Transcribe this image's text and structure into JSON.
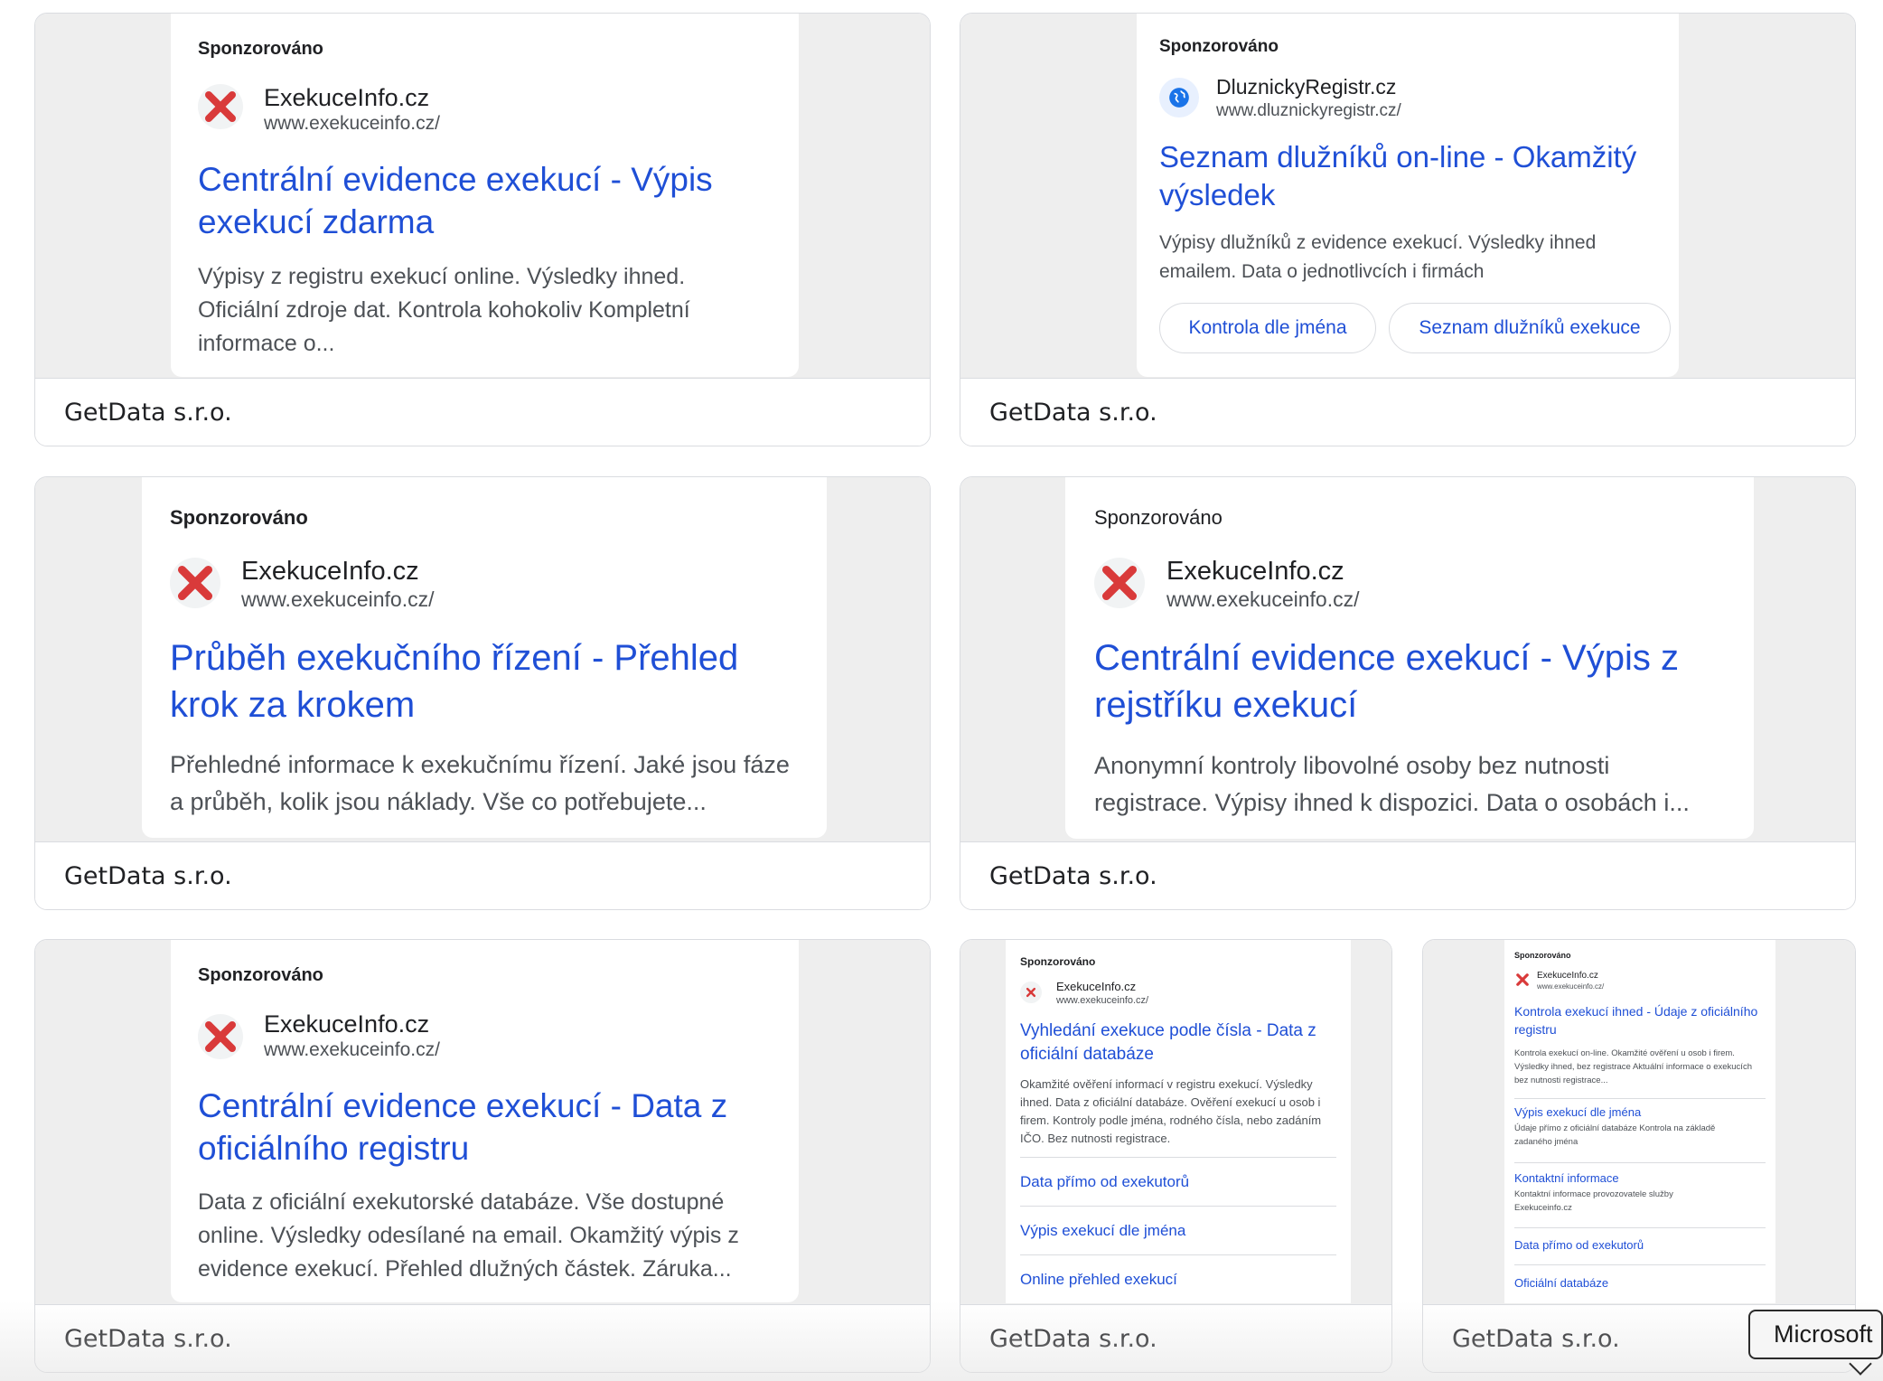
{
  "colors": {
    "link": "#1f4fd6",
    "border": "#dadce0",
    "preview_bg": "#eeeeee",
    "logo_red": "#d93a3a"
  },
  "tooltip": {
    "label": "Microsoft"
  },
  "cards": [
    {
      "advertiser": "GetData s.r.o.",
      "ad": {
        "sponsored": "Sponzorováno",
        "site_name": "ExekuceInfo.cz",
        "site_url": "www.exekuceinfo.cz/",
        "logo_icon": "red-x-icon",
        "headline": "Centrální evidence exekucí - Výpis exekucí zdarma",
        "description": "Výpisy z registru exekucí online. Výsledky ihned. Oficiální zdroje dat. Kontrola kohokoliv Kompletní informace o..."
      }
    },
    {
      "advertiser": "GetData s.r.o.",
      "ad": {
        "sponsored": "Sponzorováno",
        "site_name": "DluznickyRegistr.cz",
        "site_url": "www.dluznickyregistr.cz/",
        "logo_icon": "globe-icon",
        "headline": "Seznam dlužníků on-line - Okamžitý výsledek",
        "description": "Výpisy dlužníků z evidence exekucí. Výsledky ihned emailem. Data o jednotlivcích i firmách",
        "chips": [
          "Kontrola dle jména",
          "Seznam dlužníků exekuce"
        ]
      }
    },
    {
      "advertiser": "GetData s.r.o.",
      "ad": {
        "sponsored": "Sponzorováno",
        "site_name": "ExekuceInfo.cz",
        "site_url": "www.exekuceinfo.cz/",
        "logo_icon": "red-x-icon",
        "headline": "Průběh exekučního řízení - Přehled krok za krokem",
        "description": "Přehledné informace k exekučnímu řízení. Jaké jsou fáze a průběh, kolik jsou náklady. Vše co potřebujete..."
      }
    },
    {
      "advertiser": "GetData s.r.o.",
      "ad": {
        "sponsored": "Sponzorováno",
        "site_name": "ExekuceInfo.cz",
        "site_url": "www.exekuceinfo.cz/",
        "logo_icon": "red-x-icon",
        "headline": "Centrální evidence exekucí - Výpis z rejstříku exekucí",
        "description": "Anonymní kontroly libovolné osoby bez nutnosti registrace. Výpisy ihned k dispozici. Data o osobách i..."
      }
    },
    {
      "advertiser": "GetData s.r.o.",
      "ad": {
        "sponsored": "Sponzorováno",
        "site_name": "ExekuceInfo.cz",
        "site_url": "www.exekuceinfo.cz/",
        "logo_icon": "red-x-icon",
        "headline": "Centrální evidence exekucí - Data z oficiálního registru",
        "description": "Data z oficiální exekutorské databáze. Vše dostupné online. Výsledky odesílané na email. Okamžitý výpis z evidence exekucí. Přehled dlužných částek. Záruka..."
      }
    },
    {
      "advertiser": "GetData s.r.o.",
      "ad": {
        "sponsored": "Sponzorováno",
        "site_name": "ExekuceInfo.cz",
        "site_url": "www.exekuceinfo.cz/",
        "logo_icon": "red-x-icon",
        "headline": "Vyhledání exekuce podle čísla - Data z oficiální databáze",
        "description": "Okamžité ověření informací v registru exekucí. Výsledky ihned. Data z oficiální databáze. Ověření exekucí u osob i firem. Kontroly podle jména, rodného čísla, nebo zadáním IČO. Bez nutnosti registrace.",
        "sitelinks": [
          "Data přímo od exekutorů",
          "Výpis exekucí dle jména",
          "Online přehled exekucí"
        ]
      }
    },
    {
      "advertiser": "GetData s.r.o.",
      "ad": {
        "sponsored": "Sponzorováno",
        "site_name": "ExekuceInfo.cz",
        "site_url": "www.exekuceinfo.cz/",
        "logo_icon": "red-x-icon",
        "headline": "Kontrola exekucí ihned - Údaje z oficiálního registru",
        "description": "Kontrola exekucí on-line. Okamžité ověření u osob i firem. Výsledky ihned, bez registrace Aktuální informace o exekucích bez nutnosti registrace...",
        "sitelinks": [
          {
            "title": "Výpis exekucí dle jména",
            "desc": "Údaje přímo z oficiální databáze Kontrola na základě zadaného jména"
          },
          {
            "title": "Kontaktní informace",
            "desc": "Kontaktní informace provozovatele služby Exekuceinfo.cz"
          },
          {
            "title": "Data přímo od exekutorů",
            "desc": ""
          },
          {
            "title": "Oficiální databáze",
            "desc": ""
          }
        ]
      }
    }
  ]
}
